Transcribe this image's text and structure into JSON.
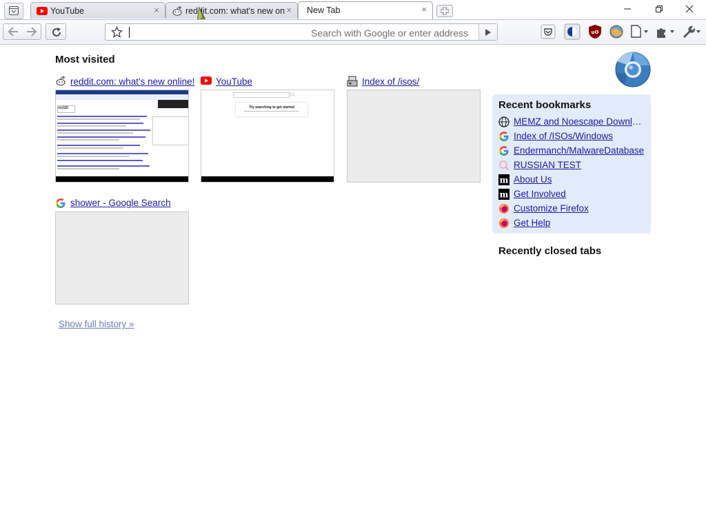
{
  "tabs": [
    {
      "title": "YouTube",
      "favicon": "youtube-icon",
      "active": false
    },
    {
      "title": "reddit.com: what's new onli",
      "favicon": "reddit-icon",
      "active": false
    },
    {
      "title": "New Tab",
      "favicon": "",
      "active": true
    }
  ],
  "toolbar": {
    "url_placeholder": "Search with Google or enter address",
    "url_value": ""
  },
  "most_visited": {
    "heading": "Most visited",
    "tiles": [
      {
        "title": "reddit.com: what's new online!",
        "favicon": "reddit-icon"
      },
      {
        "title": "YouTube",
        "favicon": "youtube-icon",
        "thumb_text": "Try searching to get started"
      },
      {
        "title": "Index of /isos/",
        "favicon": "server-icon"
      },
      {
        "title": "shower - Google Search",
        "favicon": "google-icon"
      }
    ],
    "show_history": "Show full history »"
  },
  "recent_bookmarks": {
    "heading": "Recent bookmarks",
    "items": [
      {
        "label": "MEMZ and Noescape Download",
        "icon": "globe-icon"
      },
      {
        "label": "Index of /ISOs/Windows",
        "icon": "google-icon"
      },
      {
        "label": "Endermanch/MalwareDatabase",
        "icon": "google-icon"
      },
      {
        "label": "RUSSIAN TEST",
        "icon": "search-icon"
      },
      {
        "label": "About Us",
        "icon": "mozilla-icon"
      },
      {
        "label": "Get Involved",
        "icon": "mozilla-icon"
      },
      {
        "label": "Customize Firefox",
        "icon": "firefox-icon"
      },
      {
        "label": "Get Help",
        "icon": "firefox-icon"
      }
    ]
  },
  "recently_closed": {
    "heading": "Recently closed tabs"
  },
  "colors": {
    "link": "#1a1aa6",
    "panel": "#e2ebf9",
    "youtube_red": "#ff0000"
  }
}
